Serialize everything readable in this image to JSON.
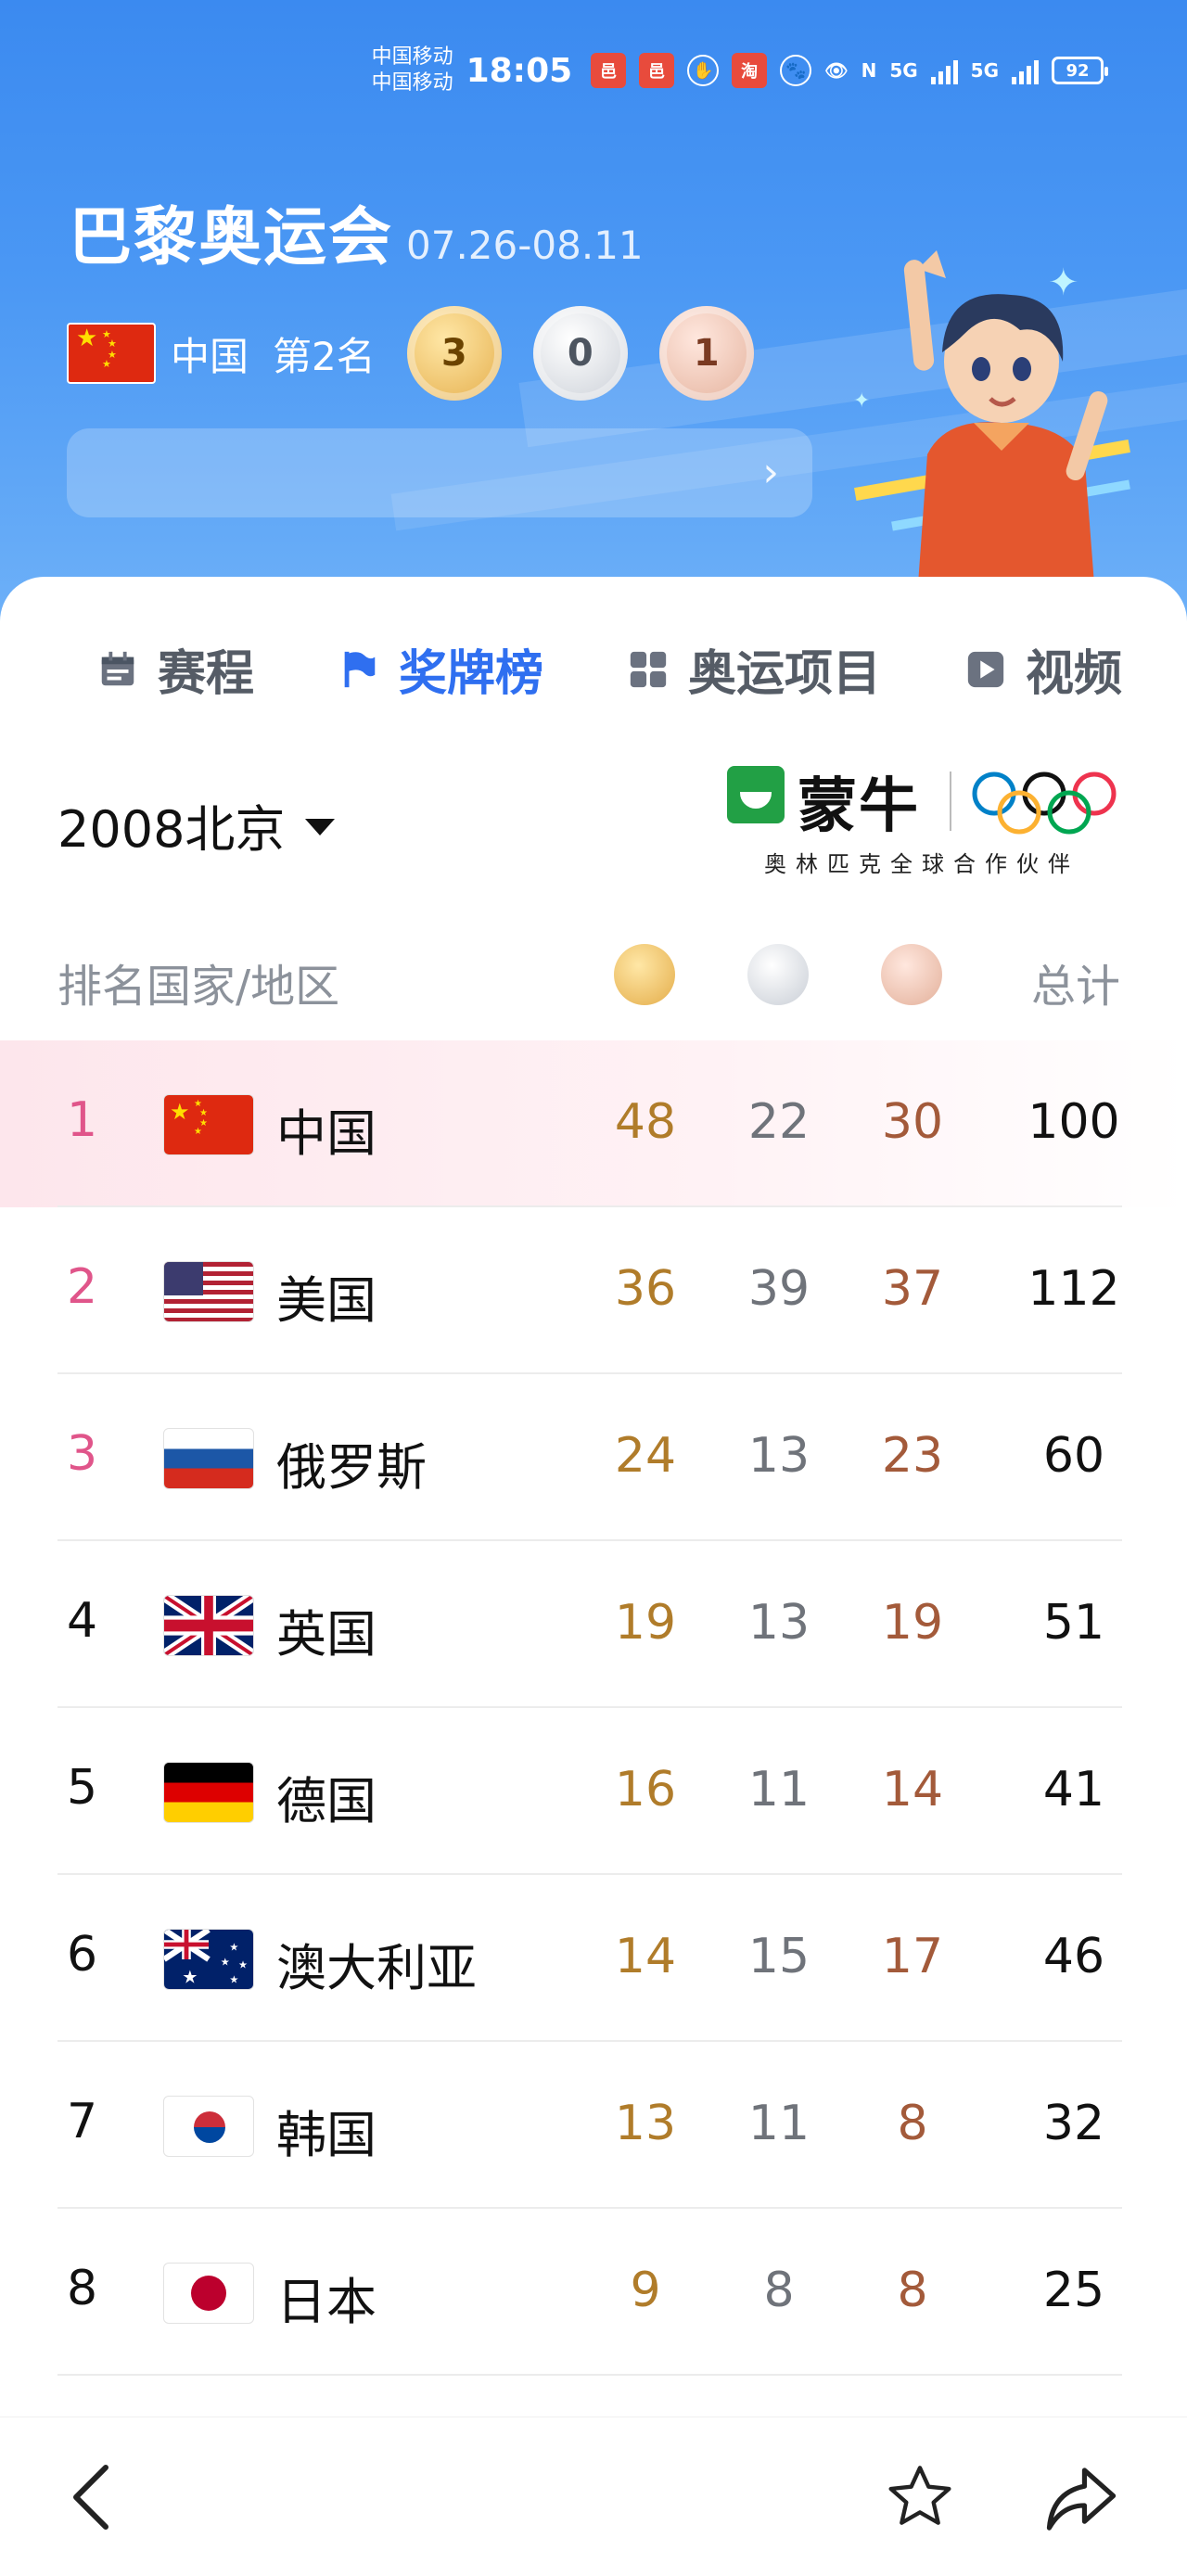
{
  "status_bar": {
    "carrier1": "中国移动",
    "carrier2": "中国移动",
    "time": "18:05",
    "battery": "92",
    "network1": "5G",
    "network2": "5G"
  },
  "header": {
    "title": "巴黎奥运会",
    "dates": "07.26-08.11",
    "country": "中国",
    "rank": "第2名",
    "gold": "3",
    "silver": "0",
    "bronze": "1"
  },
  "tabs": [
    {
      "label": "赛程",
      "icon": "calendar-icon"
    },
    {
      "label": "奖牌榜",
      "icon": "flag-icon"
    },
    {
      "label": "奥运项目",
      "icon": "grid-icon"
    },
    {
      "label": "视频",
      "icon": "play-icon"
    }
  ],
  "selector": {
    "value": "2008北京"
  },
  "sponsor": {
    "name": "蒙牛",
    "subtitle": "奥林匹克全球合作伙伴"
  },
  "table": {
    "headers": {
      "rank_country": "排名国家/地区",
      "total": "总计"
    },
    "rows": [
      {
        "rank": "1",
        "country": "中国",
        "gold": "48",
        "silver": "22",
        "bronze": "30",
        "total": "100"
      },
      {
        "rank": "2",
        "country": "美国",
        "gold": "36",
        "silver": "39",
        "bronze": "37",
        "total": "112"
      },
      {
        "rank": "3",
        "country": "俄罗斯",
        "gold": "24",
        "silver": "13",
        "bronze": "23",
        "total": "60"
      },
      {
        "rank": "4",
        "country": "英国",
        "gold": "19",
        "silver": "13",
        "bronze": "19",
        "total": "51"
      },
      {
        "rank": "5",
        "country": "德国",
        "gold": "16",
        "silver": "11",
        "bronze": "14",
        "total": "41"
      },
      {
        "rank": "6",
        "country": "澳大利亚",
        "gold": "14",
        "silver": "15",
        "bronze": "17",
        "total": "46"
      },
      {
        "rank": "7",
        "country": "韩国",
        "gold": "13",
        "silver": "11",
        "bronze": "8",
        "total": "32"
      },
      {
        "rank": "8",
        "country": "日本",
        "gold": "9",
        "silver": "8",
        "bronze": "8",
        "total": "25"
      }
    ]
  },
  "colors": {
    "accent": "#2f6ff0",
    "top_rank": "#e0558a",
    "gold_text": "#b07c2a",
    "silver_text": "#6f737a",
    "bronze_text": "#a35a3a"
  }
}
